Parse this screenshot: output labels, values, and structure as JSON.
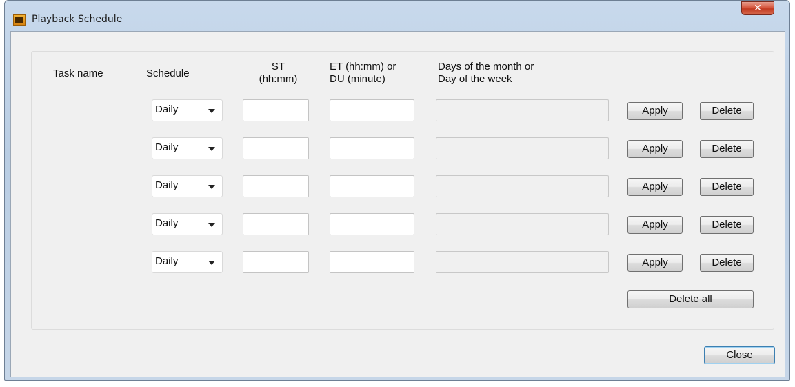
{
  "window": {
    "title": "Playback Schedule",
    "close_glyph": "✕",
    "icon": "app-logo-icon"
  },
  "headers": {
    "task_name": "Task name",
    "schedule": "Schedule",
    "st_line1": "ST",
    "st_line2": "(hh:mm)",
    "et_line1": "ET (hh:mm) or",
    "et_line2": "DU (minute)",
    "days_line1": "Days of the month or",
    "days_line2": "Day of the week"
  },
  "rows": [
    {
      "schedule": "Daily",
      "st": "",
      "et": "",
      "days": "",
      "apply": "Apply",
      "delete": "Delete"
    },
    {
      "schedule": "Daily",
      "st": "",
      "et": "",
      "days": "",
      "apply": "Apply",
      "delete": "Delete"
    },
    {
      "schedule": "Daily",
      "st": "",
      "et": "",
      "days": "",
      "apply": "Apply",
      "delete": "Delete"
    },
    {
      "schedule": "Daily",
      "st": "",
      "et": "",
      "days": "",
      "apply": "Apply",
      "delete": "Delete"
    },
    {
      "schedule": "Daily",
      "st": "",
      "et": "",
      "days": "",
      "apply": "Apply",
      "delete": "Delete"
    }
  ],
  "buttons": {
    "delete_all": "Delete all",
    "close": "Close"
  }
}
